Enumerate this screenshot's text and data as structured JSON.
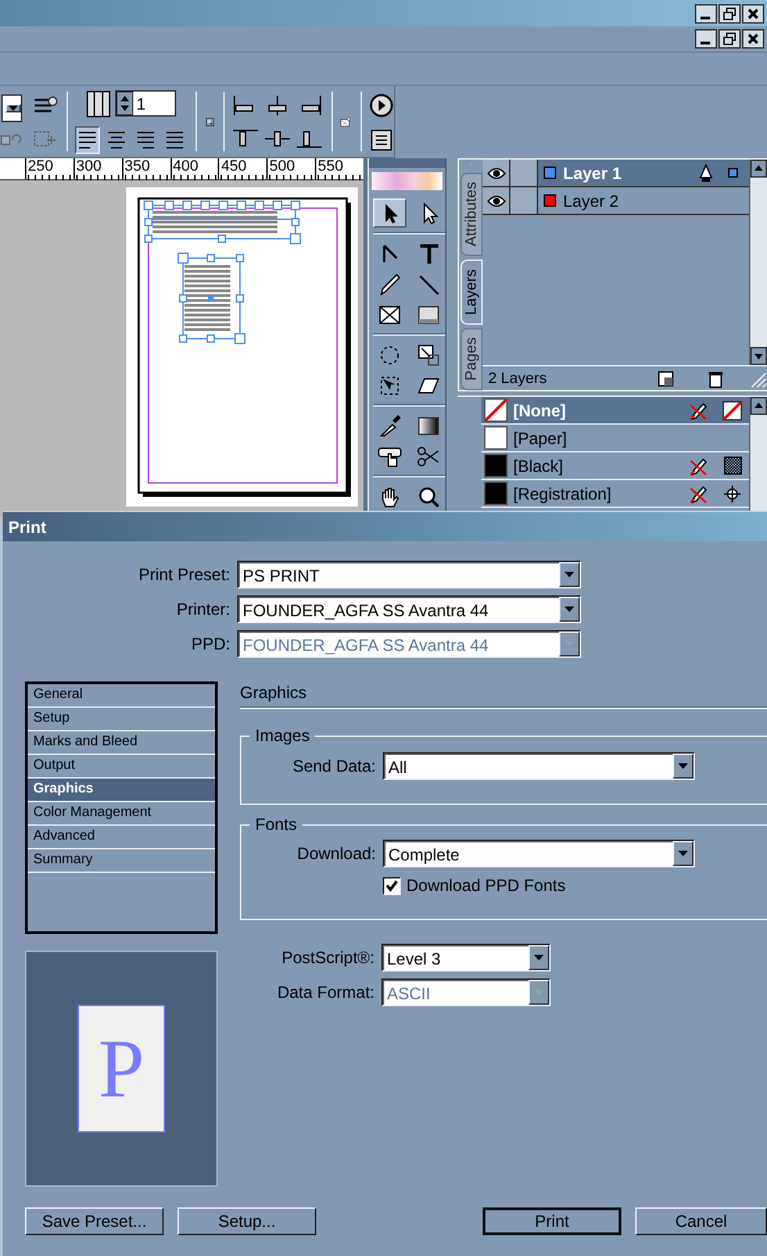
{
  "control_palette": {
    "columns_value": "1",
    "alignment_buttons": [
      {
        "kind": "left",
        "selected": true
      },
      {
        "kind": "center",
        "selected": false
      },
      {
        "kind": "right",
        "selected": false
      },
      {
        "kind": "justify",
        "selected": false
      }
    ]
  },
  "ruler": {
    "labels": [
      "250",
      "300",
      "350",
      "400",
      "450",
      "500",
      "550"
    ]
  },
  "toolbox": {
    "tools": [
      {
        "kind": "selection",
        "selected": true
      },
      {
        "kind": "direct",
        "selected": false
      },
      {
        "kind": "pen",
        "selected": false
      },
      {
        "kind": "type",
        "selected": false
      },
      {
        "kind": "pencil",
        "selected": false
      },
      {
        "kind": "line",
        "selected": false
      },
      {
        "kind": "frame",
        "selected": false
      },
      {
        "kind": "rectangle",
        "selected": false
      },
      {
        "kind": "rotate",
        "selected": false
      },
      {
        "kind": "scale",
        "selected": false
      },
      {
        "kind": "transform",
        "selected": false
      },
      {
        "kind": "shear",
        "selected": false
      },
      {
        "kind": "eyedropper",
        "selected": false
      },
      {
        "kind": "gradient",
        "selected": false
      },
      {
        "kind": "button",
        "selected": false
      },
      {
        "kind": "scissors",
        "selected": false
      },
      {
        "kind": "hand",
        "selected": false
      },
      {
        "kind": "zoom",
        "selected": false
      }
    ]
  },
  "layers_panel": {
    "tabs": [
      {
        "label": "Attributes",
        "selected": false
      },
      {
        "label": "Layers",
        "selected": true
      },
      {
        "label": "Pages",
        "selected": false
      }
    ],
    "layers": [
      {
        "name": "Layer 1",
        "color": "#4a8ef0",
        "visible": true,
        "selected": true
      },
      {
        "name": "Layer 2",
        "color": "#ff0000",
        "visible": true,
        "selected": false
      }
    ],
    "status": "2 Layers"
  },
  "swatches": [
    {
      "name": "[None]",
      "kind": "none",
      "selected": true
    },
    {
      "name": "[Paper]",
      "kind": "paper",
      "selected": false
    },
    {
      "name": "[Black]",
      "kind": "black",
      "selected": false
    },
    {
      "name": "[Registration]",
      "kind": "registration",
      "selected": false
    }
  ],
  "print_dialog": {
    "title": "Print",
    "fields": [
      {
        "label": "Print Preset:",
        "value": "PS PRINT",
        "disabled": false
      },
      {
        "label": "Printer:",
        "value": "FOUNDER_AGFA SS Avantra 44",
        "disabled": false
      },
      {
        "label": "PPD:",
        "value": "FOUNDER_AGFA SS Avantra 44",
        "disabled": true
      }
    ],
    "sections": [
      {
        "label": "General",
        "selected": false
      },
      {
        "label": "Setup",
        "selected": false
      },
      {
        "label": "Marks and Bleed",
        "selected": false
      },
      {
        "label": "Output",
        "selected": false
      },
      {
        "label": "Graphics",
        "selected": true
      },
      {
        "label": "Color Management",
        "selected": false
      },
      {
        "label": "Advanced",
        "selected": false
      },
      {
        "label": "Summary",
        "selected": false
      }
    ],
    "heading": "Graphics",
    "images_group": {
      "title": "Images",
      "send_data": {
        "label": "Send Data:",
        "value": "All",
        "disabled": false
      }
    },
    "fonts_group": {
      "title": "Fonts",
      "download": {
        "label": "Download:",
        "value": "Complete",
        "disabled": false
      },
      "download_ppd_fonts": {
        "label": "Download PPD Fonts",
        "checked": true
      }
    },
    "postscript": {
      "label": "PostScript®:",
      "value": "Level 3",
      "disabled": false
    },
    "data_format": {
      "label": "Data Format:",
      "value": "ASCII",
      "disabled": true
    },
    "preview_letter": "P",
    "buttons": [
      {
        "label": "Save Preset...",
        "default": false
      },
      {
        "label": "Setup...",
        "default": false
      },
      {
        "label": "Print",
        "default": true
      },
      {
        "label": "Cancel",
        "default": false
      }
    ]
  }
}
